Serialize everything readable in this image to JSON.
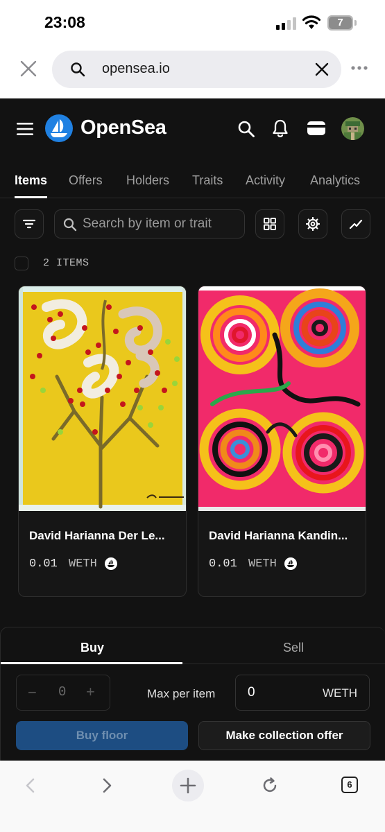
{
  "status_bar": {
    "time": "23:08",
    "battery_level": "7"
  },
  "browser": {
    "url": "opensea.io",
    "open_tabs_count": "6"
  },
  "header": {
    "brand": "OpenSea"
  },
  "tabs": [
    {
      "label": "Items",
      "active": true
    },
    {
      "label": "Offers"
    },
    {
      "label": "Holders"
    },
    {
      "label": "Traits"
    },
    {
      "label": "Activity"
    },
    {
      "label": "Analytics"
    }
  ],
  "toolbar": {
    "search_placeholder": "Search by item or trait"
  },
  "items_count_label": "2 ITEMS",
  "items": [
    {
      "title": "David Harianna Der Le...",
      "price": "0.01",
      "currency": "WETH"
    },
    {
      "title": "David Harianna Kandin...",
      "price": "0.01",
      "currency": "WETH"
    }
  ],
  "trade": {
    "tabs": {
      "buy": "Buy",
      "sell": "Sell"
    },
    "quantity": "0",
    "quantity_minus": "−",
    "quantity_plus": "+",
    "max_label": "Max per item",
    "max_price": "0",
    "max_unit": "WETH",
    "buy_floor": "Buy floor",
    "collection_offer": "Make collection offer"
  },
  "colors": {
    "accent": "#2081e2",
    "background": "#121212",
    "buy_floor_disabled": "#1d4d82"
  }
}
